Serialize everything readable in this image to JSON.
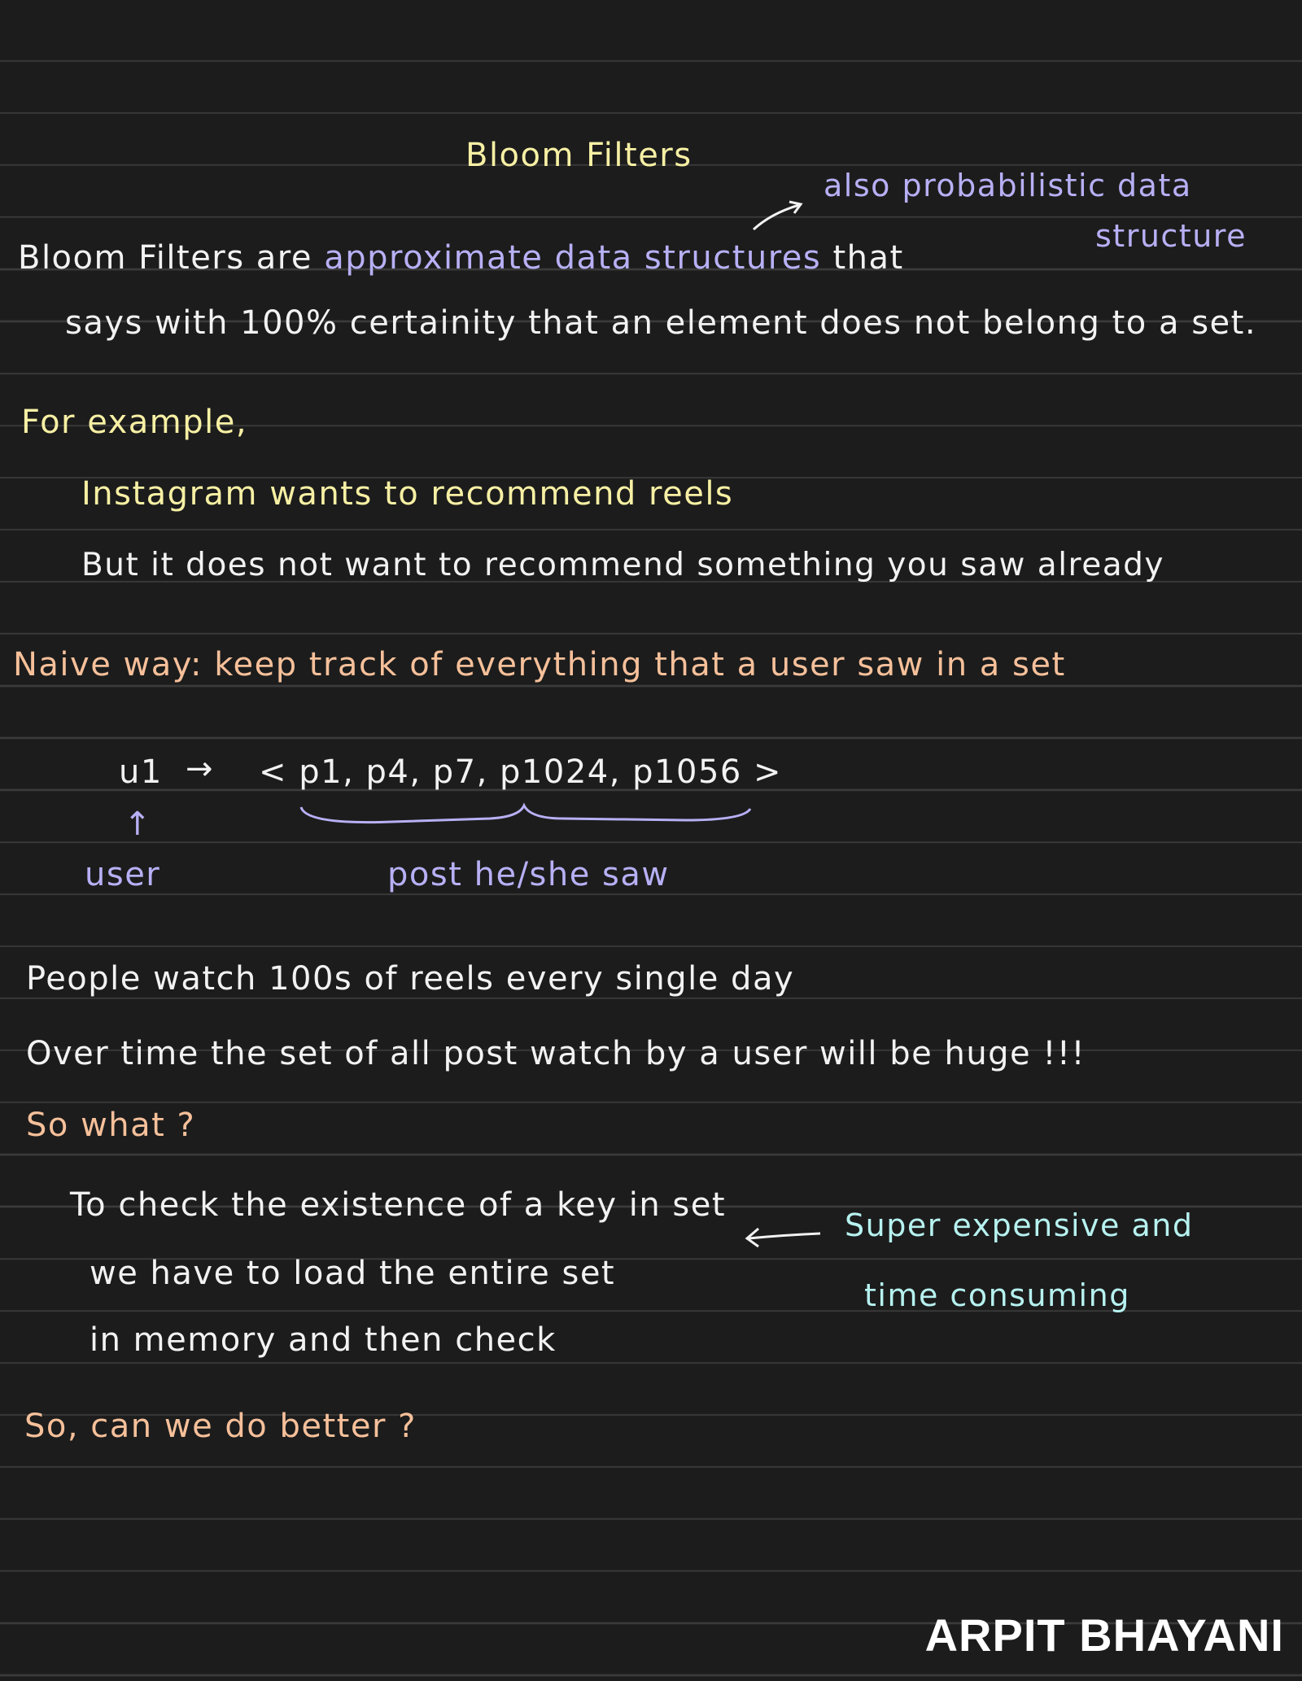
{
  "title": "Bloom Filters",
  "side_note": {
    "line1": "also probabilistic data",
    "line2": "structure"
  },
  "definition": {
    "line1_start": "Bloom Filters are",
    "line1_highlight": "approximate data structures",
    "line1_end": "that",
    "line2": "says with 100% certainity that an element does not belong to a set."
  },
  "example": {
    "heading": "For example,",
    "line1": "Instagram wants to recommend reels",
    "line2": "But it does not want to recommend something you saw already"
  },
  "naive": {
    "label": "Naive way:",
    "text": "keep track of everything that a user saw in a set"
  },
  "set_diagram": {
    "user_key": "u1",
    "arrow": "→",
    "posts": "< p1, p4, p7, p1024, p1056 >",
    "up_arrow": "↑",
    "user_label": "user",
    "posts_label": "post he/she saw"
  },
  "problem": {
    "line1": "People watch 100s of reels every single day",
    "line2": "Over time the set of all post watch by a user will be huge !!!",
    "question": "So what ?"
  },
  "check": {
    "line1": "To check the existence of a key in set",
    "line2": "we have to load the entire set",
    "line3": "in memory and then check",
    "note_line1": "Super expensive and",
    "note_line2": "time consuming"
  },
  "closing": "So, can we do better ?",
  "brand": "ARPIT BHAYANI",
  "colors": {
    "background": "#1c1c1c",
    "yellow": "#f7f0a4",
    "purple": "#b7b0f5",
    "orange": "#f6c09a",
    "cyan": "#b6f2f0",
    "white": "#f2f2f2"
  }
}
